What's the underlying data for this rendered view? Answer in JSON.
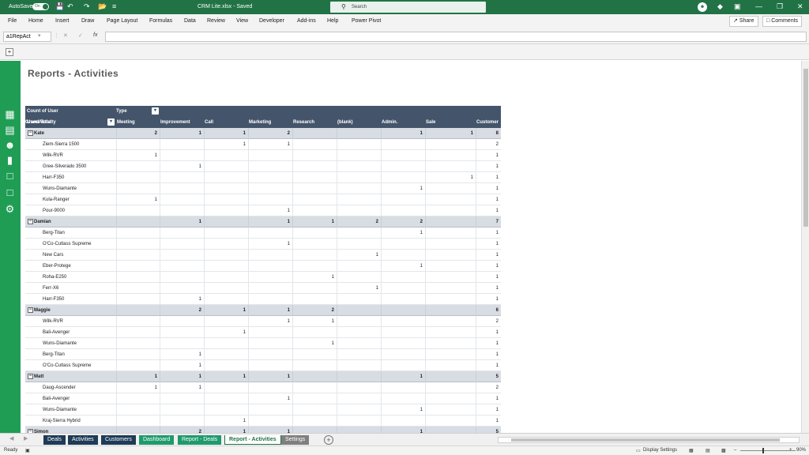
{
  "titlebar": {
    "autosave_label": "AutoSave",
    "autosave_state": "On",
    "doc_title": "CRM Lite.xlsx  -  Saved",
    "search_placeholder": "Search"
  },
  "menu": [
    "File",
    "Home",
    "Insert",
    "Draw",
    "Page Layout",
    "Formulas",
    "Data",
    "Review",
    "View",
    "Developer",
    "Add-ins",
    "Help",
    "Power Pivot"
  ],
  "menu_buttons": {
    "share": "Share",
    "comments": "Comments"
  },
  "formula": {
    "name_box": "a1RepAct",
    "fx": "fx",
    "value": ""
  },
  "page": {
    "title": "Reports - Activities"
  },
  "pivot": {
    "measure_label": "Count of User",
    "column_field": "Type",
    "row_field": "User/Activity",
    "columns": [
      "Meeting",
      "Improvement",
      "Call",
      "Marketing",
      "Research",
      "(blank)",
      "Admin.",
      "Sale",
      "Customer",
      "Grand Total"
    ],
    "rows": [
      {
        "group": true,
        "label": "Kate",
        "values": [
          "2",
          "1",
          "1",
          "2",
          "",
          "",
          "1",
          "1",
          "8"
        ]
      },
      {
        "label": "Ziem-Sierra 1500",
        "values": [
          "",
          "",
          "1",
          "1",
          "",
          "",
          "",
          "",
          "2"
        ]
      },
      {
        "label": "Wilk-RVR",
        "values": [
          "1",
          "",
          "",
          "",
          "",
          "",
          "",
          "",
          "1"
        ]
      },
      {
        "label": "Gree-Silverado 3500",
        "values": [
          "",
          "1",
          "",
          "",
          "",
          "",
          "",
          "",
          "1"
        ]
      },
      {
        "label": "Harr-F350",
        "values": [
          "",
          "",
          "",
          "",
          "",
          "",
          "",
          "1",
          "1"
        ]
      },
      {
        "label": "Wuns-Diamante",
        "values": [
          "",
          "",
          "",
          "",
          "",
          "",
          "1",
          "",
          "1"
        ]
      },
      {
        "label": "Kula-Ranger",
        "values": [
          "1",
          "",
          "",
          "",
          "",
          "",
          "",
          "",
          "1"
        ]
      },
      {
        "label": "Pour-9000",
        "values": [
          "",
          "",
          "",
          "1",
          "",
          "",
          "",
          "",
          "1"
        ]
      },
      {
        "group": true,
        "label": "Damian",
        "values": [
          "",
          "1",
          "",
          "1",
          "1",
          "2",
          "2",
          "",
          "7"
        ]
      },
      {
        "label": "Berg-Titan",
        "values": [
          "",
          "",
          "",
          "",
          "",
          "",
          "1",
          "",
          "1"
        ]
      },
      {
        "label": "O'Co-Cutlass Supreme",
        "values": [
          "",
          "",
          "",
          "1",
          "",
          "",
          "",
          "",
          "1"
        ]
      },
      {
        "label": "New Cars",
        "values": [
          "",
          "",
          "",
          "",
          "",
          "1",
          "",
          "",
          "1"
        ]
      },
      {
        "label": "Eber-Protege",
        "values": [
          "",
          "",
          "",
          "",
          "",
          "",
          "1",
          "",
          "1"
        ]
      },
      {
        "label": "Roha-E250",
        "values": [
          "",
          "",
          "",
          "",
          "1",
          "",
          "",
          "",
          "1"
        ]
      },
      {
        "label": "Ferr-X6",
        "values": [
          "",
          "",
          "",
          "",
          "",
          "1",
          "",
          "",
          "1"
        ]
      },
      {
        "label": "Harr-F350",
        "values": [
          "",
          "1",
          "",
          "",
          "",
          "",
          "",
          "",
          "1"
        ]
      },
      {
        "group": true,
        "label": "Maggie",
        "values": [
          "",
          "2",
          "1",
          "1",
          "2",
          "",
          "",
          "",
          "6"
        ]
      },
      {
        "label": "Wilk-RVR",
        "values": [
          "",
          "",
          "",
          "1",
          "1",
          "",
          "",
          "",
          "2"
        ]
      },
      {
        "label": "Bali-Avenger",
        "values": [
          "",
          "",
          "1",
          "",
          "",
          "",
          "",
          "",
          "1"
        ]
      },
      {
        "label": "Wuns-Diamante",
        "values": [
          "",
          "",
          "",
          "",
          "1",
          "",
          "",
          "",
          "1"
        ]
      },
      {
        "label": "Berg-Titan",
        "values": [
          "",
          "1",
          "",
          "",
          "",
          "",
          "",
          "",
          "1"
        ]
      },
      {
        "label": "O'Co-Cutlass Supreme",
        "values": [
          "",
          "1",
          "",
          "",
          "",
          "",
          "",
          "",
          "1"
        ]
      },
      {
        "group": true,
        "label": "Matt",
        "values": [
          "1",
          "1",
          "1",
          "1",
          "",
          "",
          "1",
          "",
          "5"
        ]
      },
      {
        "label": "Daug-Ascender",
        "values": [
          "1",
          "1",
          "",
          "",
          "",
          "",
          "",
          "",
          "2"
        ]
      },
      {
        "label": "Bali-Avenger",
        "values": [
          "",
          "",
          "",
          "1",
          "",
          "",
          "",
          "",
          "1"
        ]
      },
      {
        "label": "Wuns-Diamante",
        "values": [
          "",
          "",
          "",
          "",
          "",
          "",
          "1",
          "",
          "1"
        ]
      },
      {
        "label": "Kraj-Sierra Hybrid",
        "values": [
          "",
          "",
          "1",
          "",
          "",
          "",
          "",
          "",
          "1"
        ]
      },
      {
        "group": true,
        "label": "Simon",
        "values": [
          "",
          "2",
          "1",
          "1",
          "",
          "",
          "1",
          "",
          "5"
        ]
      }
    ]
  },
  "tabs": [
    {
      "label": "Deals",
      "style": "dark"
    },
    {
      "label": "Activities",
      "style": "dark"
    },
    {
      "label": "Customers",
      "style": "dark"
    },
    {
      "label": "Dashboard",
      "style": "green"
    },
    {
      "label": "Report - Deals",
      "style": "green"
    },
    {
      "label": "Report - Activities",
      "style": "active"
    },
    {
      "label": "Settings",
      "style": "gray"
    }
  ],
  "status": {
    "ready": "Ready",
    "display_settings": "Display Settings",
    "zoom": "90%"
  }
}
